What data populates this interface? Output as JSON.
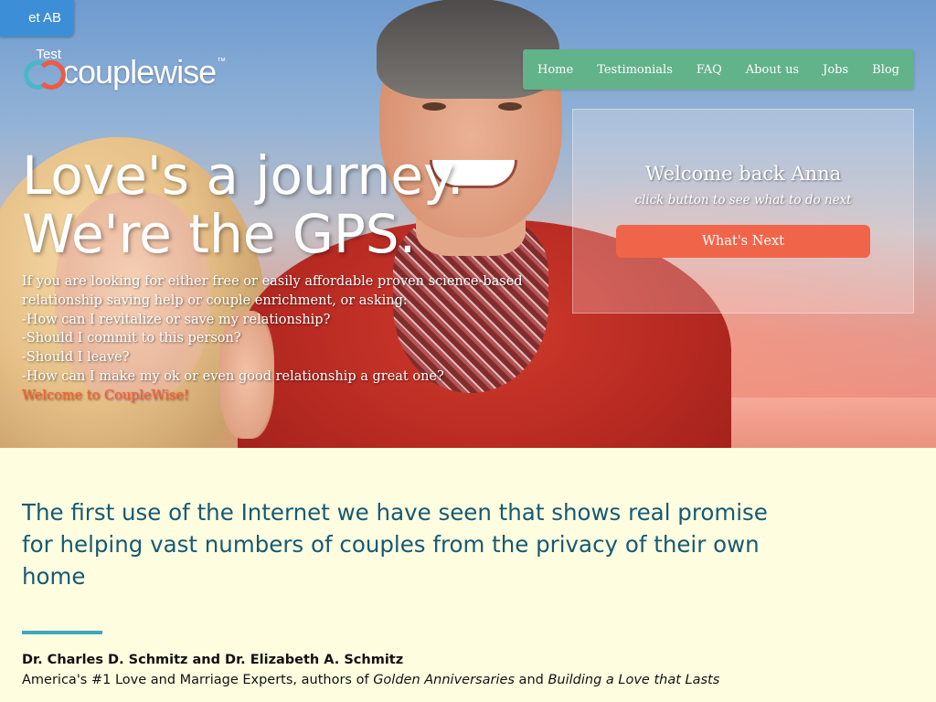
{
  "ab_test": {
    "label": "et AB Test"
  },
  "logo": {
    "text": "couplewise",
    "tm": "™"
  },
  "nav": {
    "items": [
      "Home",
      "Testimonials",
      "FAQ",
      "About us",
      "Jobs",
      "Blog"
    ]
  },
  "hero": {
    "headline_line1": "Love's a journey.",
    "headline_line2": "We're the GPS.",
    "intro_lines": [
      "If you are looking for either free or easily affordable proven science-based",
      "relationship saving help or couple enrichment, or asking:",
      "-How can I revitalize or save my relationship?",
      "-Should I commit to this person?",
      "-Should I leave?",
      "-How can I make my ok or even good relationship a great one?"
    ],
    "welcome_line": "Welcome to CoupleWise!"
  },
  "welcome_panel": {
    "title": "Welcome back Anna",
    "subtitle": "click button to see what to do next",
    "button_label": "What's Next"
  },
  "testimonial": {
    "quote": "The first use of the Internet we have seen that shows real promise for helping vast numbers of couples from the privacy of their own home",
    "author": "Dr. Charles D. Schmitz and Dr. Elizabeth A. Schmitz",
    "desc_prefix": "America's #1 Love and Marriage Experts, authors of ",
    "book1": "Golden Anniversaries",
    "desc_and": " and ",
    "book2": "Building a Love that Lasts"
  },
  "colors": {
    "nav_bg": "#62b28a",
    "button": "#f0654a",
    "quote_text": "#155a73",
    "page_bg": "#fffde0",
    "accent_red": "#ff5a2a"
  }
}
